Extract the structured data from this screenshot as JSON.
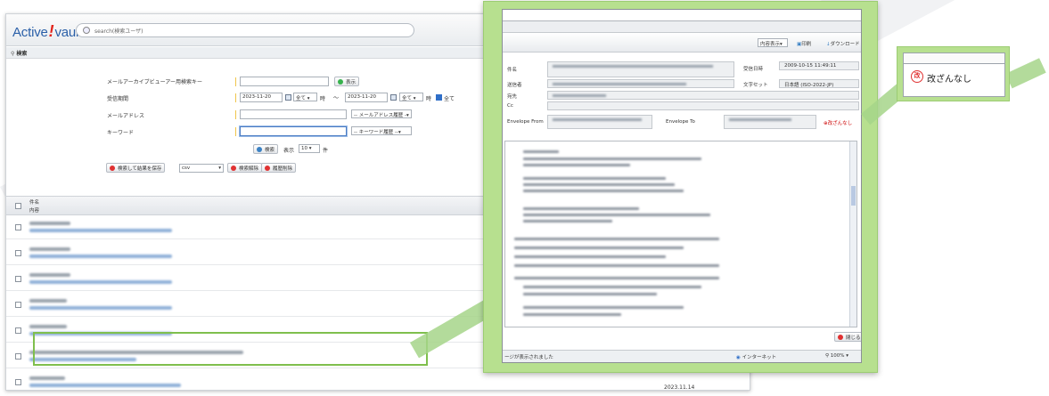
{
  "app": {
    "logo_part1": "Active",
    "logo_bang": "!",
    "logo_part2": "vault",
    "header_search_placeholder": "search(検索ユーザ)"
  },
  "section": {
    "title": "検索"
  },
  "form": {
    "key_label": "メールアーカイブビューアー用検索キー",
    "show_button": "表示",
    "period_label": "受信期間",
    "date_from": "2023-11-20",
    "all_label_1": "全て",
    "hour_label_1": "時",
    "tilde": "～",
    "date_to": "2023-11-20",
    "all_label_2": "全て",
    "hour_label_2": "時",
    "all_check_label": "全て",
    "address_label": "メールアドレス",
    "address_history": "-- メールアドレス履歴 -",
    "keyword_label": "キーワード",
    "keyword_history": "-- キーワード履歴 --",
    "search_button": "検索",
    "display_label": "表示",
    "count_value": "10",
    "count_unit": "件",
    "save_button": "検索して結果を保存",
    "format_value": "csv",
    "clear_button": "検索解除",
    "history_delete_button": "履歴削除"
  },
  "list": {
    "col_subject": "件名",
    "col_body": "内容",
    "date_value": "2023.11.14"
  },
  "viewer": {
    "toolbar_select": "内容表示",
    "toolbar_print": "印刷",
    "toolbar_download": "ダウンロード",
    "label_subject": "件名",
    "label_from": "送信者",
    "label_to": "宛先",
    "label_cc": "Cc",
    "label_date": "受信日時",
    "date_value": "2009-10-15 11:49:11",
    "label_charset": "文字セット",
    "charset_value": "日本語 (ISO-2022-JP)",
    "label_envelope_from": "Envelope From",
    "label_envelope_to": "Envelope To",
    "kaizan_small": "改ざんなし",
    "close_button": "閉じる",
    "status_text": "ージが表示されました",
    "internet_label": "インターネット",
    "zoom_value": "100%"
  },
  "callout": {
    "icon_char": "改",
    "text": "改ざんなし"
  },
  "colors": {
    "brand_blue": "#2a5fa8",
    "brand_red": "#e2231a",
    "highlight_green": "#7fbf4d",
    "callout_green": "#b7e08f"
  }
}
